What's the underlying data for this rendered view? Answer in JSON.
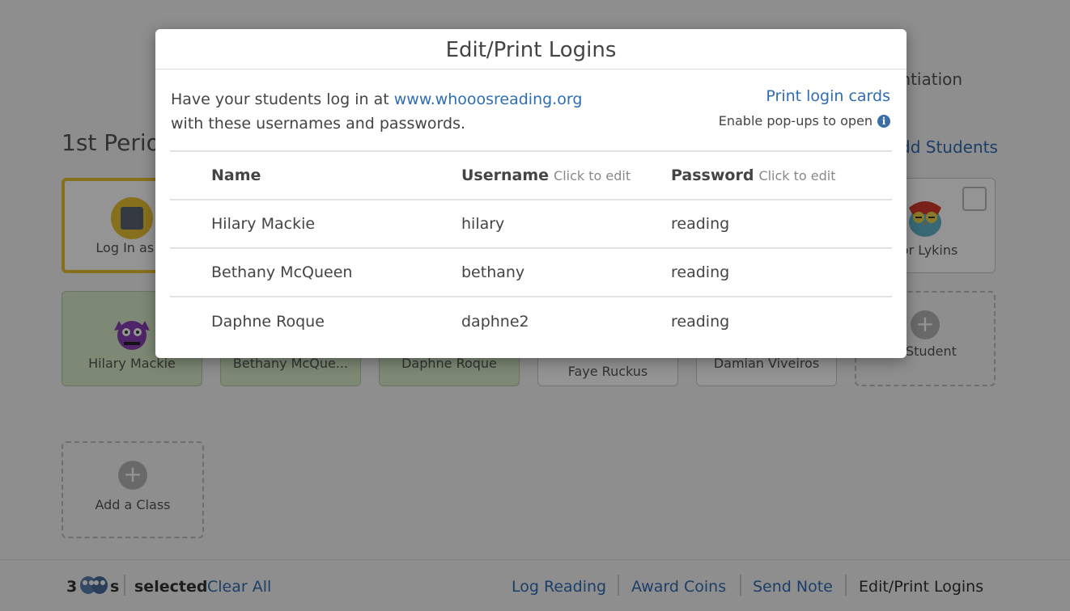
{
  "background": {
    "differentiation_fragment": "erentiation",
    "period_title": "1st Perio",
    "add_students_fragment": "dd Students",
    "cards": {
      "login_as": "Log In as D",
      "row1_last": "dor Lykins",
      "row2": [
        "Hilary Mackie",
        "Bethany McQue...",
        "Daphne Roque",
        "Faye Ruckus",
        "Damian Viveiros"
      ],
      "add_student": "a Student",
      "add_class": "Add a Class",
      "plus": "+"
    }
  },
  "bottom_bar": {
    "count": "3",
    "count_suffix": "s",
    "selected_label": "selected",
    "clear_all": "Clear All",
    "actions": [
      "Log Reading",
      "Award Coins",
      "Send Note",
      "Edit/Print Logins"
    ],
    "active_action": "Edit/Print Logins"
  },
  "modal": {
    "title": "Edit/Print Logins",
    "intro_prefix": "Have your students log in at ",
    "intro_link": "www.whooosreading.org",
    "intro_suffix": "with these usernames and passwords.",
    "print_link": "Print login cards",
    "popup_note": "Enable pop-ups to open",
    "info_icon_glyph": "i",
    "columns": {
      "name": "Name",
      "username": "Username",
      "password": "Password",
      "edit_hint": "Click to edit"
    },
    "rows": [
      {
        "name": "Hilary Mackie",
        "username": "hilary",
        "password": "reading"
      },
      {
        "name": "Bethany McQueen",
        "username": "bethany",
        "password": "reading"
      },
      {
        "name": "Daphne Roque",
        "username": "daphne2",
        "password": "reading"
      }
    ]
  },
  "colors": {
    "link": "#2f6db3",
    "selected_card": "#d8ecc8",
    "highlight_card_border": "#e9c233"
  }
}
